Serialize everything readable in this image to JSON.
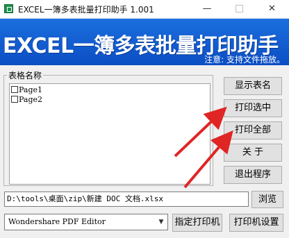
{
  "window": {
    "title": "EXCEL一簿多表批量打印助手  1.001",
    "min_glyph": "—",
    "close_glyph": "✕"
  },
  "banner": {
    "title": "EXCEL一簿多表批量打印助手",
    "note": "注意: 支持文件拖放。",
    "color": "#1560d6"
  },
  "sheet_group": {
    "label": "表格名称",
    "items": [
      {
        "label": "Page1",
        "checked": false
      },
      {
        "label": "Page2",
        "checked": false
      }
    ]
  },
  "buttons": {
    "show_sheets": "显示表名",
    "print_selected": "打印选中",
    "print_all": "打印全部",
    "about": "关    于",
    "exit": "退出程序",
    "browse": "浏览",
    "set_printer": "指定打印机",
    "printer_settings": "打印机设置"
  },
  "file_path": {
    "value": "D:\\tools\\桌面\\zip\\新建 DOC 文档.xlsx"
  },
  "printer_select": {
    "selected": "Wondershare PDF Editor",
    "arrow_glyph": "▼"
  },
  "annotations": {
    "arrow_color": "#e02525"
  }
}
